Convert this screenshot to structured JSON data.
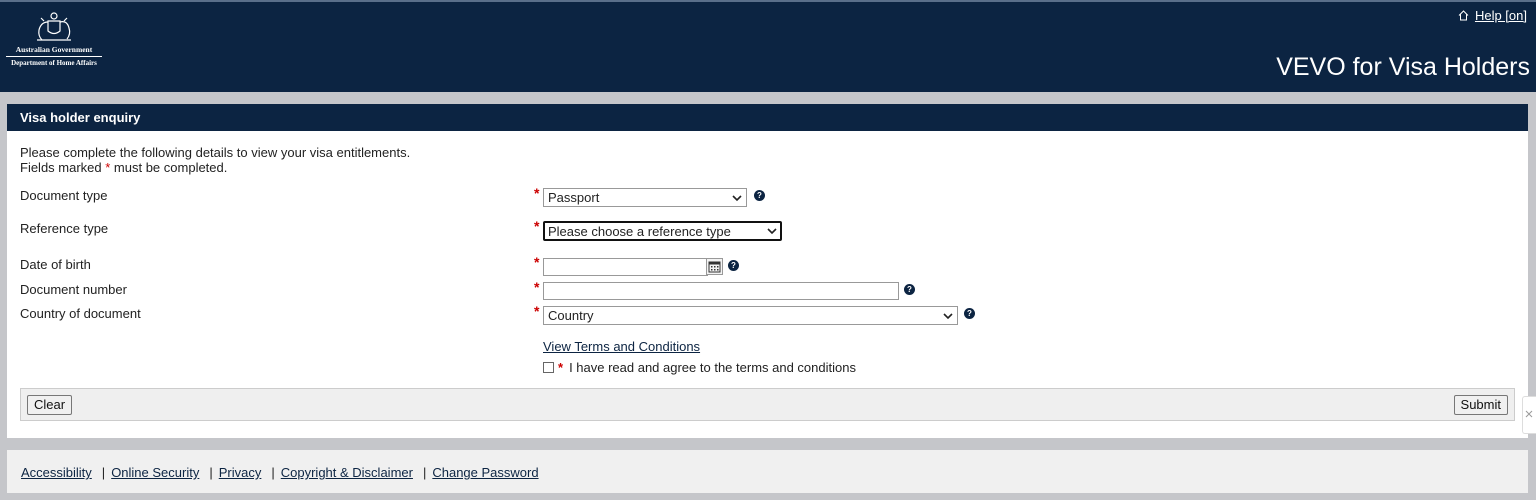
{
  "header": {
    "logo": {
      "line1": "Australian Government",
      "line2": "Department of Home Affairs"
    },
    "help_label": "Help [on]",
    "app_title": "VEVO for Visa Holders"
  },
  "panel": {
    "title": "Visa holder enquiry",
    "intro_line1": "Please complete the following details to view your visa entitlements.",
    "intro_line2_a": "Fields marked ",
    "intro_line2_star": "*",
    "intro_line2_b": " must be completed.",
    "required_mark": "*",
    "help_glyph": "?",
    "fields": {
      "document_type": {
        "label": "Document type",
        "value": "Passport"
      },
      "reference_type": {
        "label": "Reference type",
        "value": "Please choose a reference type"
      },
      "date_of_birth": {
        "label": "Date of birth",
        "value": ""
      },
      "document_number": {
        "label": "Document number",
        "value": ""
      },
      "country": {
        "label": "Country of document",
        "value": "Country"
      }
    },
    "terms_link": "View Terms and Conditions",
    "agree_text": "I have read and agree to the terms and conditions",
    "buttons": {
      "clear": "Clear",
      "submit": "Submit"
    }
  },
  "footer": {
    "links": [
      "Accessibility",
      "Online Security",
      "Privacy",
      "Copyright & Disclaimer",
      "Change Password"
    ],
    "separator": "|"
  },
  "colors": {
    "navy": "#0c2442",
    "required": "#cc0000",
    "page_bg": "#c5c6ca"
  },
  "icons": {
    "logo": "coat-of-arms-icon",
    "help": "home-icon",
    "field_help": "question-circle-icon",
    "date": "calendar-icon",
    "select": "chevron-down-icon"
  }
}
